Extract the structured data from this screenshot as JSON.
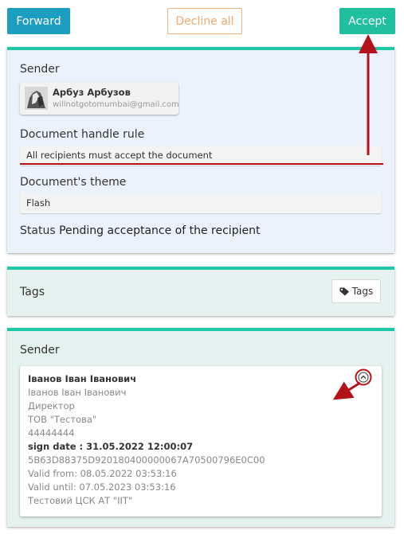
{
  "toolbar": {
    "forward_label": "Forward",
    "decline_label": "Decline all",
    "accept_label": "Accept"
  },
  "document": {
    "sender_heading": "Sender",
    "sender": {
      "name": "Арбуз Арбузов",
      "email": "willnotgotomumbai@gmail.com"
    },
    "handle_rule_heading": "Document handle rule",
    "handle_rule_value": "All recipients must accept the document",
    "theme_heading": "Document's theme",
    "theme_value": "Flash",
    "status_label": "Status",
    "status_value": "Pending acceptance of the recipient"
  },
  "tags": {
    "heading": "Tags",
    "button_label": "Tags",
    "button_icon": "tag-icon"
  },
  "signature": {
    "heading": "Sender",
    "signer_bold": "Іванов Іван Іванович",
    "signer_name": "Іванов Іван Іванович",
    "position": "Директор",
    "organization": "ТОВ \"Тестова\"",
    "code": "44444444",
    "sign_date_label": "sign date :",
    "sign_date_value": "31.05.2022 12:00:07",
    "serial": "5B63D88375D920180400000067A70500796E0C00",
    "valid_from": "Valid from: 08.05.2022 03:53:16",
    "valid_until": "Valid until: 07.05.2023 03:53:16",
    "issuer": "Тестовий ЦСК АТ \"ІІТ\"",
    "collapse_icon": "chevron-up-icon"
  },
  "colors": {
    "forward": "#1b9ec2",
    "accept": "#1fbfa0",
    "decline_text": "#f0a96a",
    "panel_accent": "#1ec7a5",
    "annotation": "#b5111a"
  }
}
